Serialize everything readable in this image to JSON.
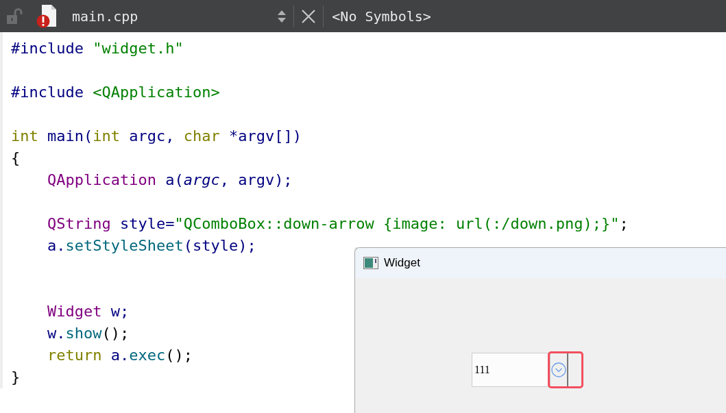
{
  "editor_toolbar": {
    "file_name": "main.cpp",
    "symbols": "<No Symbols>",
    "locked": false,
    "has_error": true
  },
  "code_lines": [
    {
      "kind": "code",
      "tokens": [
        {
          "text": "#include ",
          "kind": "directive"
        },
        {
          "text": "\"widget.h\"",
          "kind": "string"
        }
      ]
    },
    {
      "kind": "blank"
    },
    {
      "kind": "code",
      "tokens": [
        {
          "text": "#include ",
          "kind": "directive"
        },
        {
          "text": "<QApplication>",
          "kind": "string"
        }
      ]
    },
    {
      "kind": "blank"
    },
    {
      "kind": "code",
      "tokens": [
        {
          "text": "int",
          "kind": "keyword"
        },
        {
          "text": " main(",
          "kind": "name"
        },
        {
          "text": "int",
          "kind": "keyword"
        },
        {
          "text": " argc, ",
          "kind": "name"
        },
        {
          "text": "char",
          "kind": "keyword"
        },
        {
          "text": " *argv[])",
          "kind": "name"
        }
      ]
    },
    {
      "kind": "code",
      "tokens": [
        {
          "text": "{",
          "kind": "plain"
        }
      ]
    },
    {
      "kind": "code",
      "tokens": [
        {
          "text": "    QApplication",
          "kind": "class"
        },
        {
          "text": " a(",
          "kind": "name"
        },
        {
          "text": "argc",
          "kind": "param"
        },
        {
          "text": ", argv);",
          "kind": "name"
        }
      ]
    },
    {
      "kind": "blank"
    },
    {
      "kind": "code",
      "tokens": [
        {
          "text": "    QString",
          "kind": "class"
        },
        {
          "text": " style=",
          "kind": "name"
        },
        {
          "text": "\"QComboBox::down-arrow {image: url(:/down.png);}\"",
          "kind": "string"
        },
        {
          "text": ";",
          "kind": "plain"
        }
      ]
    },
    {
      "kind": "code",
      "tokens": [
        {
          "text": "    a.",
          "kind": "name"
        },
        {
          "text": "setStyleSheet",
          "kind": "method"
        },
        {
          "text": "(style);",
          "kind": "name"
        }
      ]
    },
    {
      "kind": "blank"
    },
    {
      "kind": "blank"
    },
    {
      "kind": "code",
      "tokens": [
        {
          "text": "    Widget",
          "kind": "class"
        },
        {
          "text": " w;",
          "kind": "name"
        }
      ]
    },
    {
      "kind": "code",
      "tokens": [
        {
          "text": "    w.",
          "kind": "name"
        },
        {
          "text": "show",
          "kind": "method"
        },
        {
          "text": "();",
          "kind": "plain"
        }
      ]
    },
    {
      "kind": "code",
      "tokens": [
        {
          "text": "    return",
          "kind": "keyword"
        },
        {
          "text": " a.",
          "kind": "name"
        },
        {
          "text": "exec",
          "kind": "method"
        },
        {
          "text": "();",
          "kind": "plain"
        }
      ]
    },
    {
      "kind": "code",
      "tokens": [
        {
          "text": "}",
          "kind": "plain"
        }
      ]
    }
  ],
  "widget_window": {
    "title": "Widget",
    "combo_value": "111",
    "dropdown_highlighted": true
  }
}
